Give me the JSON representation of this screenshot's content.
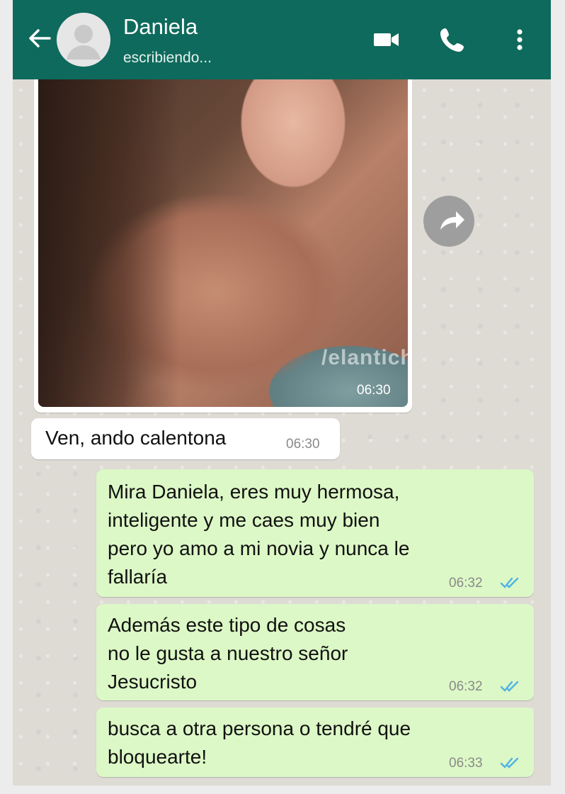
{
  "contact": {
    "name": "Daniela",
    "status": "escribiendo..."
  },
  "watermark": "/elantich",
  "icons": {
    "back": "back-arrow-icon",
    "avatar": "default-avatar-icon",
    "video": "video-camera-icon",
    "call": "phone-icon",
    "menu": "more-vert-icon",
    "forward": "forward-share-icon",
    "ticks": "double-check-icon"
  },
  "colors": {
    "header": "#0e6a5c",
    "outgoing": "#dcf8c6",
    "ticks": "#4fb3e6"
  },
  "messages": [
    {
      "type": "image",
      "direction": "in",
      "time": "06:30"
    },
    {
      "type": "text",
      "direction": "in",
      "lines": [
        "Ven, ando calentona"
      ],
      "time": "06:30"
    },
    {
      "type": "text",
      "direction": "out",
      "lines": [
        "Mira Daniela, eres muy hermosa,",
        "inteligente y me caes muy bien",
        "pero yo amo a mi novia y nunca le",
        "fallaría"
      ],
      "time": "06:32"
    },
    {
      "type": "text",
      "direction": "out",
      "lines": [
        "Además este tipo de cosas",
        "no le gusta a nuestro señor",
        "Jesucristo"
      ],
      "time": "06:32"
    },
    {
      "type": "text",
      "direction": "out",
      "lines": [
        "busca a otra persona o tendré que",
        "bloquearte!"
      ],
      "time": "06:33"
    }
  ]
}
